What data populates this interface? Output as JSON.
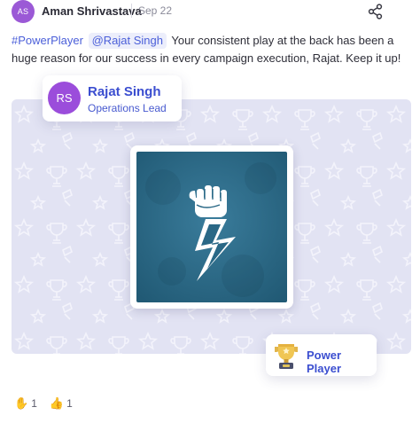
{
  "post": {
    "author_initials": "AS",
    "author_name": "Aman Shrivastava",
    "date": "Sep 22",
    "hashtag": "#PowerPlayer",
    "mention": "@Rajat Singh",
    "message": "Your consistent play at the back has been a huge reason for our success in every campaign execution, Rajat. Keep it up!"
  },
  "recipient": {
    "initials": "RS",
    "name": "Rajat Singh",
    "role": "Operations Lead"
  },
  "award": {
    "label": "Power Player",
    "icon": "trophy-icon",
    "poster_icon": "raised-fist-lightning-icon"
  },
  "reactions": [
    {
      "emoji": "✋",
      "icon": "raised-hand-icon",
      "count": "1"
    },
    {
      "emoji": "👍",
      "icon": "thumbs-up-icon",
      "count": "1"
    }
  ],
  "colors": {
    "accent": "#3b4ed0",
    "avatar_small": "#9b59d6",
    "avatar_large": "#9b4ddb",
    "card_bg": "#e2e3f3",
    "poster_bg": "#2e6f8f"
  }
}
